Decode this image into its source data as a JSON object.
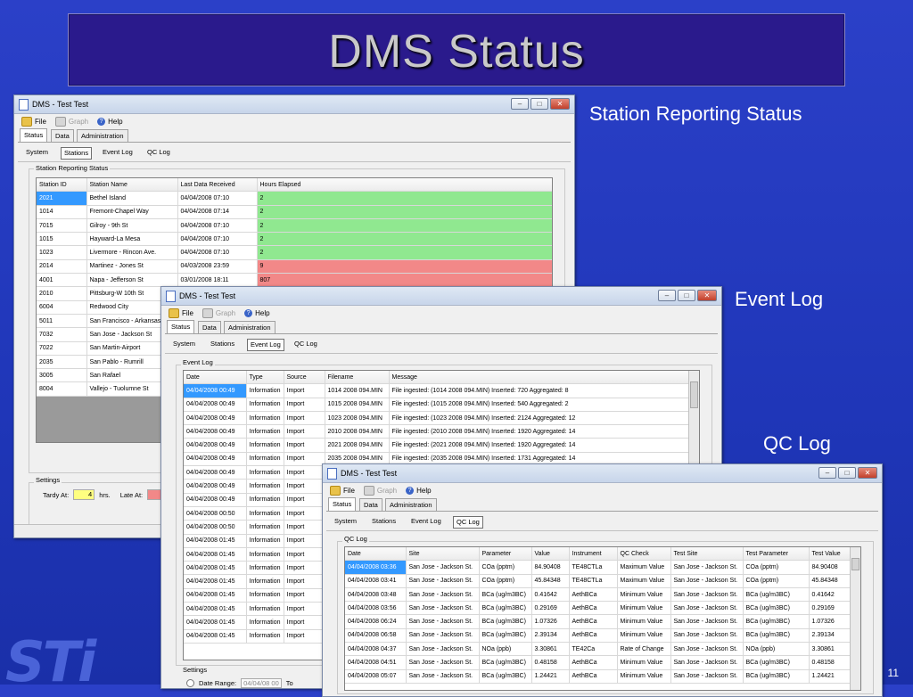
{
  "slide": {
    "title": "DMS Status",
    "number": "11",
    "logo_text": "STi"
  },
  "captions": {
    "station": "Station Reporting Status",
    "event": "Event Log",
    "qc": "QC Log"
  },
  "app": {
    "window_title": "DMS - Test Test",
    "menu": {
      "file": "File",
      "graph": "Graph",
      "help": "Help"
    },
    "tabs": {
      "status": "Status",
      "data": "Data",
      "admin": "Administration"
    },
    "subtabs": {
      "system": "System",
      "stations": "Stations",
      "event_log": "Event Log",
      "qc_log": "QC Log"
    }
  },
  "station_window": {
    "group_label": "Station Reporting Status",
    "headers": [
      "Station ID",
      "Station Name",
      "Last Data Received",
      "Hours Elapsed"
    ],
    "rows": [
      [
        "2021",
        "Bethel Island",
        "04/04/2008 07:10",
        "2"
      ],
      [
        "1014",
        "Fremont-Chapel Way",
        "04/04/2008 07:14",
        "2"
      ],
      [
        "7015",
        "Gilroy - 9th St",
        "04/04/2008 07:10",
        "2"
      ],
      [
        "1015",
        "Hayward-La Mesa",
        "04/04/2008 07:10",
        "2"
      ],
      [
        "1023",
        "Livermore - Rincon Ave.",
        "04/04/2008 07:10",
        "2"
      ],
      [
        "2014",
        "Martinez - Jones St",
        "04/03/2008 23:59",
        "9"
      ],
      [
        "4001",
        "Napa - Jefferson St",
        "03/01/2008 18:11",
        "807"
      ],
      [
        "2010",
        "Pittsburg-W 10th St",
        "",
        ""
      ],
      [
        "6004",
        "Redwood City",
        "",
        ""
      ],
      [
        "5011",
        "San Francisco - Arkansas",
        "",
        ""
      ],
      [
        "7032",
        "San Jose - Jackson St",
        "",
        ""
      ],
      [
        "7022",
        "San Martin-Airport",
        "",
        ""
      ],
      [
        "2035",
        "San Pablo - Rumrill",
        "",
        ""
      ],
      [
        "3005",
        "San Rafael",
        "",
        ""
      ],
      [
        "8004",
        "Vallejo - Tuolumne St",
        "",
        ""
      ]
    ],
    "row_status": [
      "g",
      "g",
      "g",
      "g",
      "g",
      "r",
      "r",
      "",
      "",
      "",
      "",
      "",
      "",
      "",
      ""
    ],
    "settings_label": "Settings",
    "tardy_label": "Tardy At:",
    "tardy_value": "4",
    "hrs_label": "hrs.",
    "late_label": "Late At:"
  },
  "event_window": {
    "group_label": "Event Log",
    "headers": [
      "Date",
      "Type",
      "Source",
      "Filename",
      "Message"
    ],
    "rows": [
      [
        "04/04/2008 00:49",
        "Information",
        "Import",
        "1014 2008 094.MIN",
        "File ingested: (1014 2008 094.MIN) Inserted: 720 Aggregated: 8"
      ],
      [
        "04/04/2008 00:49",
        "Information",
        "Import",
        "1015 2008 094.MIN",
        "File ingested: (1015 2008 094.MIN) Inserted: 540 Aggregated: 2"
      ],
      [
        "04/04/2008 00:49",
        "Information",
        "Import",
        "1023 2008 094.MIN",
        "File ingested: (1023 2008 094.MIN) Inserted: 2124 Aggregated: 12"
      ],
      [
        "04/04/2008 00:49",
        "Information",
        "Import",
        "2010 2008 094.MIN",
        "File ingested: (2010 2008 094.MIN) Inserted: 1920 Aggregated: 14"
      ],
      [
        "04/04/2008 00:49",
        "Information",
        "Import",
        "2021 2008 094.MIN",
        "File ingested: (2021 2008 094.MIN) Inserted: 1920 Aggregated: 14"
      ],
      [
        "04/04/2008 00:49",
        "Information",
        "Import",
        "2035 2008 094.MIN",
        "File ingested: (2035 2008 094.MIN) Inserted: 1731 Aggregated: 14"
      ],
      [
        "04/04/2008 00:49",
        "Information",
        "Import",
        "",
        ""
      ],
      [
        "04/04/2008 00:49",
        "Information",
        "Import",
        "",
        ""
      ],
      [
        "04/04/2008 00:49",
        "Information",
        "Import",
        "",
        ""
      ],
      [
        "04/04/2008 00:50",
        "Information",
        "Import",
        "",
        ""
      ],
      [
        "04/04/2008 00:50",
        "Information",
        "Import",
        "",
        ""
      ],
      [
        "04/04/2008 01:45",
        "Information",
        "Import",
        "",
        ""
      ],
      [
        "04/04/2008 01:45",
        "Information",
        "Import",
        "",
        ""
      ],
      [
        "04/04/2008 01:45",
        "Information",
        "Import",
        "",
        ""
      ],
      [
        "04/04/2008 01:45",
        "Information",
        "Import",
        "",
        ""
      ],
      [
        "04/04/2008 01:45",
        "Information",
        "Import",
        "",
        ""
      ],
      [
        "04/04/2008 01:45",
        "Information",
        "Import",
        "",
        ""
      ],
      [
        "04/04/2008 01:45",
        "Information",
        "Import",
        "",
        ""
      ],
      [
        "04/04/2008 01:45",
        "Information",
        "Import",
        "",
        ""
      ]
    ],
    "settings_label": "Settings",
    "date_range_label": "Date Range:",
    "date_from": "04/04/08 00",
    "date_to_label": "To"
  },
  "qc_window": {
    "group_label": "QC Log",
    "headers": [
      "Date",
      "Site",
      "Parameter",
      "Value",
      "Instrument",
      "QC Check",
      "Test Site",
      "Test Parameter",
      "Test Value"
    ],
    "rows": [
      [
        "04/04/2008 03:36",
        "San Jose - Jackson St.",
        "COa (pptm)",
        "84.90408",
        "TE48CTLa",
        "Maximum Value",
        "San Jose - Jackson St.",
        "COa (pptm)",
        "84.90408"
      ],
      [
        "04/04/2008 03:41",
        "San Jose - Jackson St.",
        "COa (pptm)",
        "45.84348",
        "TE48CTLa",
        "Maximum Value",
        "San Jose - Jackson St.",
        "COa (pptm)",
        "45.84348"
      ],
      [
        "04/04/2008 03:48",
        "San Jose - Jackson St.",
        "BCa (ug/m3BC)",
        "0.41642",
        "AethBCa",
        "Minimum Value",
        "San Jose - Jackson St.",
        "BCa (ug/m3BC)",
        "0.41642"
      ],
      [
        "04/04/2008 03:56",
        "San Jose - Jackson St.",
        "BCa (ug/m3BC)",
        "0.29169",
        "AethBCa",
        "Minimum Value",
        "San Jose - Jackson St.",
        "BCa (ug/m3BC)",
        "0.29169"
      ],
      [
        "04/04/2008 06:24",
        "San Jose - Jackson St.",
        "BCa (ug/m3BC)",
        "1.07326",
        "AethBCa",
        "Minimum Value",
        "San Jose - Jackson St.",
        "BCa (ug/m3BC)",
        "1.07326"
      ],
      [
        "04/04/2008 06:58",
        "San Jose - Jackson St.",
        "BCa (ug/m3BC)",
        "2.39134",
        "AethBCa",
        "Minimum Value",
        "San Jose - Jackson St.",
        "BCa (ug/m3BC)",
        "2.39134"
      ],
      [
        "04/04/2008 04:37",
        "San Jose - Jackson St.",
        "NOa (ppb)",
        "3.30861",
        "TE42Ca",
        "Rate of Change",
        "San Jose - Jackson St.",
        "NOa (ppb)",
        "3.30861"
      ],
      [
        "04/04/2008 04:51",
        "San Jose - Jackson St.",
        "BCa (ug/m3BC)",
        "0.48158",
        "AethBCa",
        "Minimum Value",
        "San Jose - Jackson St.",
        "BCa (ug/m3BC)",
        "0.48158"
      ],
      [
        "04/04/2008 05:07",
        "San Jose - Jackson St.",
        "BCa (ug/m3BC)",
        "1.24421",
        "AethBCa",
        "Minimum Value",
        "San Jose - Jackson St.",
        "BCa (ug/m3BC)",
        "1.24421"
      ]
    ]
  }
}
